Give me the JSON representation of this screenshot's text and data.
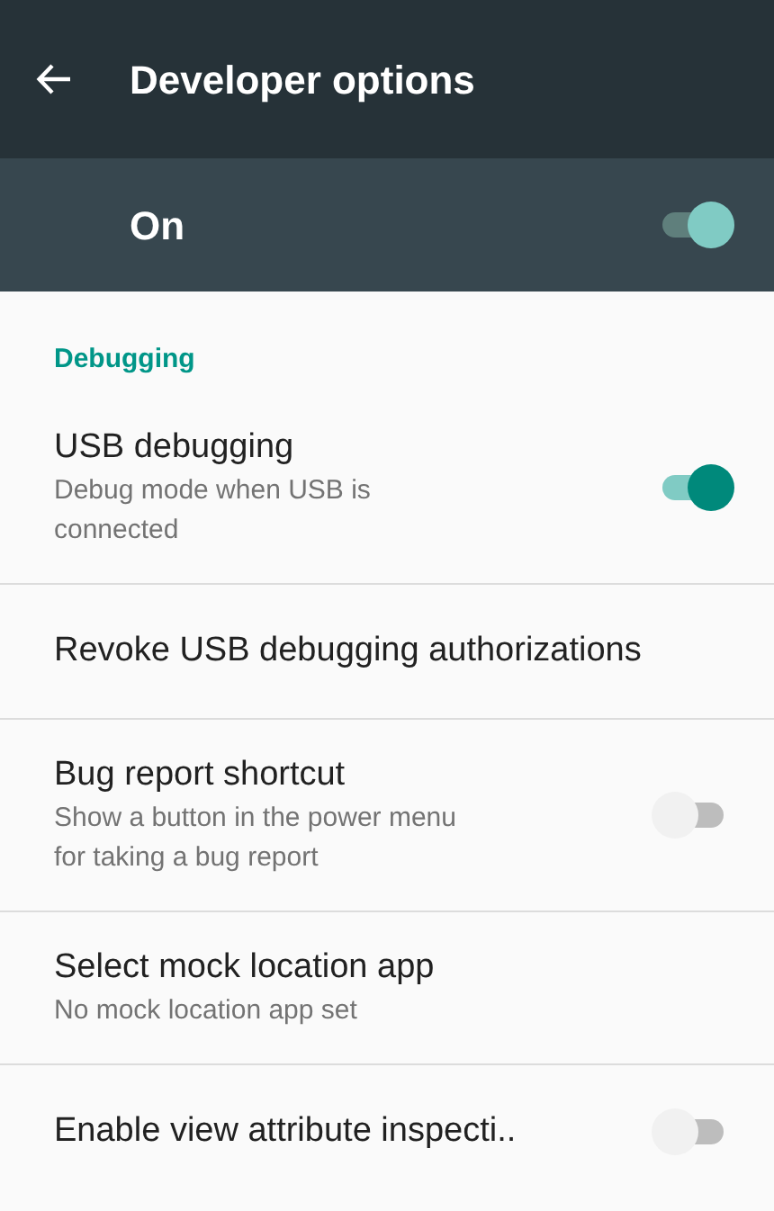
{
  "app_bar": {
    "title": "Developer options"
  },
  "master_switch": {
    "label": "On",
    "on": true
  },
  "section": {
    "title": "Debugging"
  },
  "settings": [
    {
      "kind": "toggle",
      "title": "USB debugging",
      "summary": "Debug mode when USB is connected",
      "on": true
    },
    {
      "kind": "plain",
      "title": "Revoke USB debugging authorizations"
    },
    {
      "kind": "toggle",
      "title": "Bug report shortcut",
      "summary": "Show a button in the power menu for taking a bug report",
      "on": false
    },
    {
      "kind": "plain",
      "title": "Select mock location app",
      "summary": "No mock location app set"
    },
    {
      "kind": "toggle",
      "title": "Enable view attribute inspecti..",
      "on": false
    }
  ]
}
